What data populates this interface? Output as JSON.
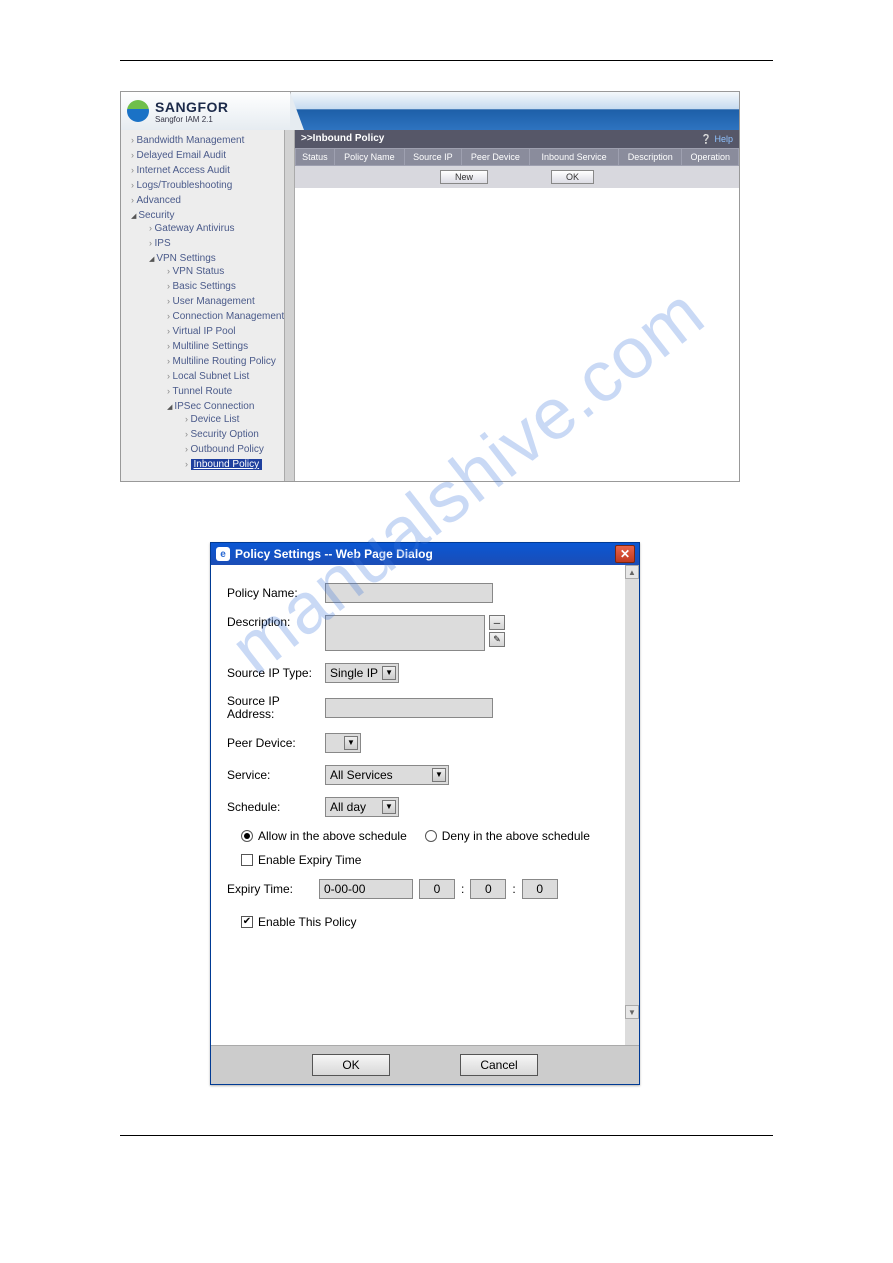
{
  "watermark": "manualshive.com",
  "brand": {
    "name": "SANGFOR",
    "sub": "Sangfor IAM 2.1"
  },
  "nav": {
    "items": [
      "Bandwidth Management",
      "Delayed Email Audit",
      "Internet Access Audit",
      "Logs/Troubleshooting",
      "Advanced"
    ],
    "security": "Security",
    "sec_children": [
      "Gateway Antivirus",
      "IPS"
    ],
    "vpn": "VPN Settings",
    "vpn_children": [
      "VPN Status",
      "Basic Settings",
      "User Management",
      "Connection Management",
      "Virtual IP Pool",
      "Multiline Settings",
      "Multiline Routing Policy",
      "Local Subnet List",
      "Tunnel Route"
    ],
    "ipsec": "IPSec Connection",
    "ipsec_children": [
      "Device List",
      "Security Option",
      "Outbound Policy"
    ],
    "ipsec_selected": "Inbound Policy"
  },
  "content": {
    "title": ">>Inbound Policy",
    "help": "Help",
    "cols": [
      "Status",
      "Policy Name",
      "Source IP",
      "Peer Device",
      "Inbound Service",
      "Description",
      "Operation"
    ],
    "btn_new": "New",
    "btn_ok": "OK"
  },
  "dialog": {
    "title": "Policy Settings -- Web Page Dialog",
    "labels": {
      "policy_name": "Policy Name:",
      "description": "Description:",
      "source_ip_type": "Source IP Type:",
      "source_ip_addr": "Source IP Address:",
      "peer_device": "Peer Device:",
      "service": "Service:",
      "schedule": "Schedule:",
      "expiry_time": "Expiry Time:"
    },
    "values": {
      "policy_name": "",
      "description": "",
      "source_ip_type": "Single IP",
      "source_ip_addr": "",
      "peer_device": "",
      "service": "All Services",
      "schedule": "All day",
      "expiry_date": "0-00-00",
      "expiry_h": "0",
      "expiry_m": "0",
      "expiry_s": "0"
    },
    "radio_allow": "Allow in the above schedule",
    "radio_deny": "Deny in the above schedule",
    "chk_expiry": "Enable Expiry Time",
    "chk_enable": "Enable This Policy",
    "btn_ok": "OK",
    "btn_cancel": "Cancel"
  }
}
